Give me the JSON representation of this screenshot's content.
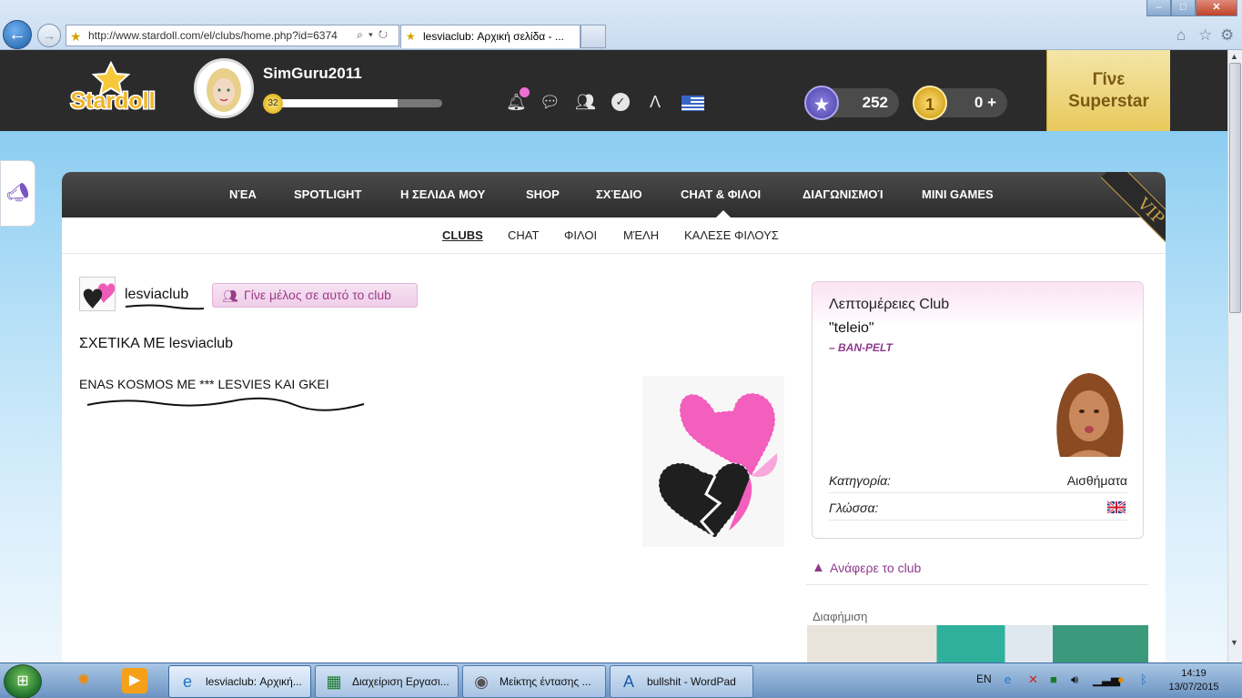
{
  "browser": {
    "url": "http://www.stardoll.com/el/clubs/home.php?id=6374",
    "tab_title": "lesviaclub: Αρχική σελίδα - ...",
    "window_controls": [
      "minimize",
      "maximize",
      "close"
    ]
  },
  "header": {
    "logo_text": "Stardoll",
    "username": "SimGuru2011",
    "level": "32",
    "xp_progress": 0.73,
    "stardollars": "252",
    "coins": "0 +",
    "superstar_label_1": "Γίνε",
    "superstar_label_2": "Superstar",
    "icons": [
      "bell-icon",
      "chat-icon",
      "friends-icon",
      "check-icon",
      "lambda-icon",
      "greek-flag-icon"
    ]
  },
  "nav": {
    "items": [
      "ΝΈΑ",
      "SPOTLIGHT",
      "Η ΣΕΛΙΔΑ ΜΟΥ",
      "SHOP",
      "ΣΧΈΔΙΟ",
      "CHAT & ΦΙΛΟΙ",
      "ΔΙΑΓΩΝΙΣΜΟΊ",
      "MINI GAMES"
    ],
    "active": "CHAT & ΦΙΛΟΙ",
    "vip_label": "VIP"
  },
  "subnav": {
    "items": [
      "CLUBS",
      "CHAT",
      "ΦΙΛΟΙ",
      "ΜΈΛΗ",
      "ΚΑΛΕΣΕ ΦΙΛΟΥΣ"
    ],
    "active": "CLUBS"
  },
  "club": {
    "name": "lesviaclub",
    "join_label": "Γίνε μέλος σε αυτό το club",
    "about_heading": "ΣΧΕΤΙΚΑ ΜΕ lesviaclub",
    "description": "ENAS KOSMOS ME *** LESVIES KAI GKEI"
  },
  "details": {
    "title": "Λεπτομέρειες Club",
    "quote": "\"teleio\"",
    "author": "– BAN-PELT",
    "category_label": "Κατηγορία:",
    "category_value": "Αισθήματα",
    "language_label": "Γλώσσα:"
  },
  "report_label": "Ανάφερε το club",
  "ad_label": "Διαφήμιση",
  "taskbar": {
    "tasks": [
      "lesviaclub: Αρχική...",
      "Διαχείριση Εργασι...",
      "Μείκτης έντασης ...",
      "bullshit - WordPad"
    ],
    "lang": "EN",
    "time": "14:19",
    "date": "13/07/2015"
  },
  "colors": {
    "header_bg": "#2b2b2b",
    "accent_purple": "#8e3b8c",
    "superstar_gold": "#e9c95c",
    "sky": "#8ccdf1"
  }
}
